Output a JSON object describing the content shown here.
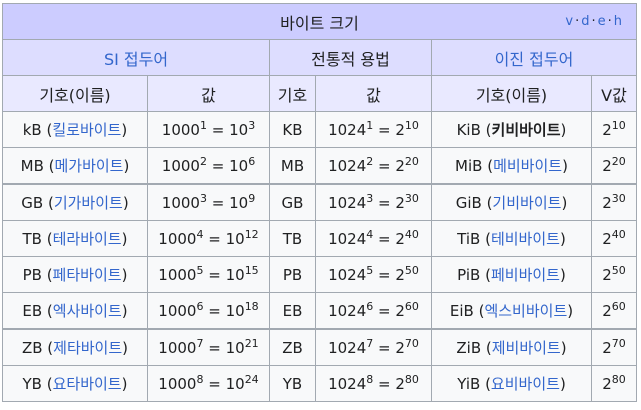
{
  "title": "바이트 크기",
  "vde": [
    "v",
    "d",
    "e",
    "h"
  ],
  "groups": {
    "si": "SI 접두어",
    "traditional": "전통적 용법",
    "binary": "이진 접두어"
  },
  "headers": {
    "si_symbol": "기호(이름)",
    "si_value": "값",
    "trad_symbol": "기호",
    "trad_value": "값",
    "bin_symbol": "기호(이름)",
    "bin_value": "V값"
  },
  "rows": [
    {
      "si_sym": "kB",
      "si_name": "킬로바이트",
      "si_base": "1000",
      "si_exp": "1",
      "si_eq_base": "10",
      "si_eq_exp": "3",
      "tr_sym": "KB",
      "tr_base": "1024",
      "tr_exp": "1",
      "tr_eq_base": "2",
      "tr_eq_exp": "10",
      "bin_sym": "KiB",
      "bin_name": "키비바이트",
      "bin_val_base": "2",
      "bin_val_exp": "10"
    },
    {
      "si_sym": "MB",
      "si_name": "메가바이트",
      "si_base": "1000",
      "si_exp": "2",
      "si_eq_base": "10",
      "si_eq_exp": "6",
      "tr_sym": "MB",
      "tr_base": "1024",
      "tr_exp": "2",
      "tr_eq_base": "2",
      "tr_eq_exp": "20",
      "bin_sym": "MiB",
      "bin_name": "메비바이트",
      "bin_val_base": "2",
      "bin_val_exp": "20"
    },
    {
      "si_sym": "GB",
      "si_name": "기가바이트",
      "si_base": "1000",
      "si_exp": "3",
      "si_eq_base": "10",
      "si_eq_exp": "9",
      "tr_sym": "GB",
      "tr_base": "1024",
      "tr_exp": "3",
      "tr_eq_base": "2",
      "tr_eq_exp": "30",
      "bin_sym": "GiB",
      "bin_name": "기비바이트",
      "bin_val_base": "2",
      "bin_val_exp": "30"
    },
    {
      "si_sym": "TB",
      "si_name": "테라바이트",
      "si_base": "1000",
      "si_exp": "4",
      "si_eq_base": "10",
      "si_eq_exp": "12",
      "tr_sym": "TB",
      "tr_base": "1024",
      "tr_exp": "4",
      "tr_eq_base": "2",
      "tr_eq_exp": "40",
      "bin_sym": "TiB",
      "bin_name": "테비바이트",
      "bin_val_base": "2",
      "bin_val_exp": "40"
    },
    {
      "si_sym": "PB",
      "si_name": "페타바이트",
      "si_base": "1000",
      "si_exp": "5",
      "si_eq_base": "10",
      "si_eq_exp": "15",
      "tr_sym": "PB",
      "tr_base": "1024",
      "tr_exp": "5",
      "tr_eq_base": "2",
      "tr_eq_exp": "50",
      "bin_sym": "PiB",
      "bin_name": "페비바이트",
      "bin_val_base": "2",
      "bin_val_exp": "50"
    },
    {
      "si_sym": "EB",
      "si_name": "엑사바이트",
      "si_base": "1000",
      "si_exp": "6",
      "si_eq_base": "10",
      "si_eq_exp": "18",
      "tr_sym": "EB",
      "tr_base": "1024",
      "tr_exp": "6",
      "tr_eq_base": "2",
      "tr_eq_exp": "60",
      "bin_sym": "EiB",
      "bin_name": "엑스비바이트",
      "bin_val_base": "2",
      "bin_val_exp": "60"
    },
    {
      "si_sym": "ZB",
      "si_name": "제타바이트",
      "si_base": "1000",
      "si_exp": "7",
      "si_eq_base": "10",
      "si_eq_exp": "21",
      "tr_sym": "ZB",
      "tr_base": "1024",
      "tr_exp": "7",
      "tr_eq_base": "2",
      "tr_eq_exp": "70",
      "bin_sym": "ZiB",
      "bin_name": "제비바이트",
      "bin_val_base": "2",
      "bin_val_exp": "70"
    },
    {
      "si_sym": "YB",
      "si_name": "요타바이트",
      "si_base": "1000",
      "si_exp": "8",
      "si_eq_base": "10",
      "si_eq_exp": "24",
      "tr_sym": "YB",
      "tr_base": "1024",
      "tr_exp": "8",
      "tr_eq_base": "2",
      "tr_eq_exp": "80",
      "bin_sym": "YiB",
      "bin_name": "요비바이트",
      "bin_val_base": "2",
      "bin_val_exp": "80"
    }
  ],
  "current_page_row": 0,
  "colors": {
    "title_bg": "#ccccff",
    "group_bg": "#ddddff",
    "header_bg": "#e9e9ff",
    "cell_bg": "#f8f9fa",
    "link": "#3366cc",
    "border": "#a2a9b1"
  }
}
